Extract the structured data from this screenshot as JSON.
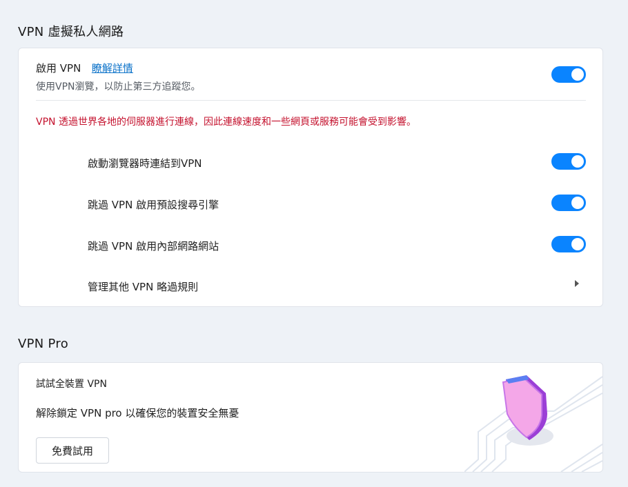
{
  "vpn_section": {
    "title": "VPN 虛擬私人網路",
    "enable": {
      "label": "啟用 VPN",
      "link": "瞭解詳情",
      "description": "使用VPN瀏覽，以防止第三方追蹤您。",
      "enabled": true
    },
    "warning": "VPN 透過世界各地的伺服器進行連線，因此連線速度和一些網頁或服務可能會受到影響。",
    "options": [
      {
        "label": "啟動瀏覽器時連結到VPN",
        "enabled": true
      },
      {
        "label": "跳過 VPN 啟用預設搜尋引擎",
        "enabled": true
      },
      {
        "label": "跳過 VPN 啟用內部網路網站",
        "enabled": true
      }
    ],
    "manage_rules": "管理其他 VPN 略過規則",
    "accent_color": "#0a84ff",
    "warning_color": "#c4112d"
  },
  "vpn_pro": {
    "title": "VPN Pro",
    "heading": "試試全裝置 VPN",
    "description": "解除鎖定 VPN pro 以確保您的裝置安全無憂",
    "button": "免費試用",
    "illustration_icon": "shield-icon"
  }
}
